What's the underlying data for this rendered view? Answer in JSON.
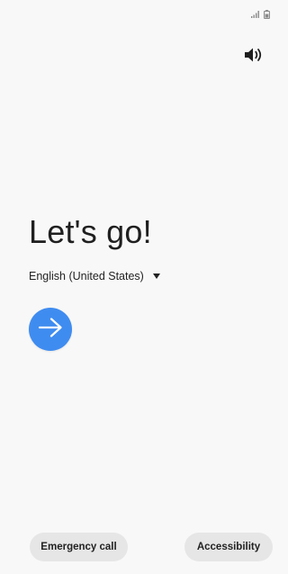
{
  "colors": {
    "background": "#f8f8f8",
    "accent": "#3f8cf0",
    "pill_background": "#e6e6e6",
    "text": "#222222"
  },
  "status_bar": {
    "icons": [
      "signal-icon",
      "battery-icon"
    ]
  },
  "sound_toggle": {
    "icon": "volume-icon"
  },
  "welcome": {
    "headline": "Let's go!",
    "language_label": "English (United States)",
    "language_dropdown_icon": "caret-down-icon",
    "next_icon": "arrow-right-icon"
  },
  "footer": {
    "emergency_label": "Emergency call",
    "accessibility_label": "Accessibility"
  }
}
